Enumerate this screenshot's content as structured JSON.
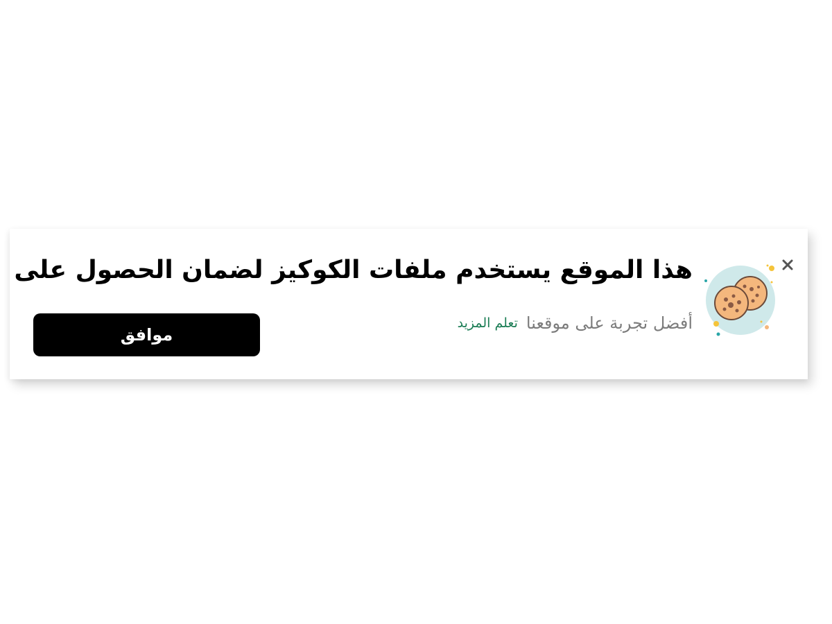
{
  "banner": {
    "headline": "هذا الموقع يستخدم ملفات الكوكيز لضمان الحصول على",
    "subtext": "أفضل تجربة على موقعنا",
    "learn_more_label": "تعلم المزيد",
    "accept_label": "موافق",
    "close_icon": "close-icon",
    "illustration_icon": "cookie-icon"
  },
  "colors": {
    "headline": "#000000",
    "subtext": "#7c7c7c",
    "link": "#1b7d55",
    "button_bg": "#000000",
    "button_text": "#ffffff",
    "icon_circle": "#cfe9ea",
    "cookie": "#f4b77d",
    "accent_yellow": "#f5c43a",
    "accent_teal": "#2aa6a8"
  }
}
